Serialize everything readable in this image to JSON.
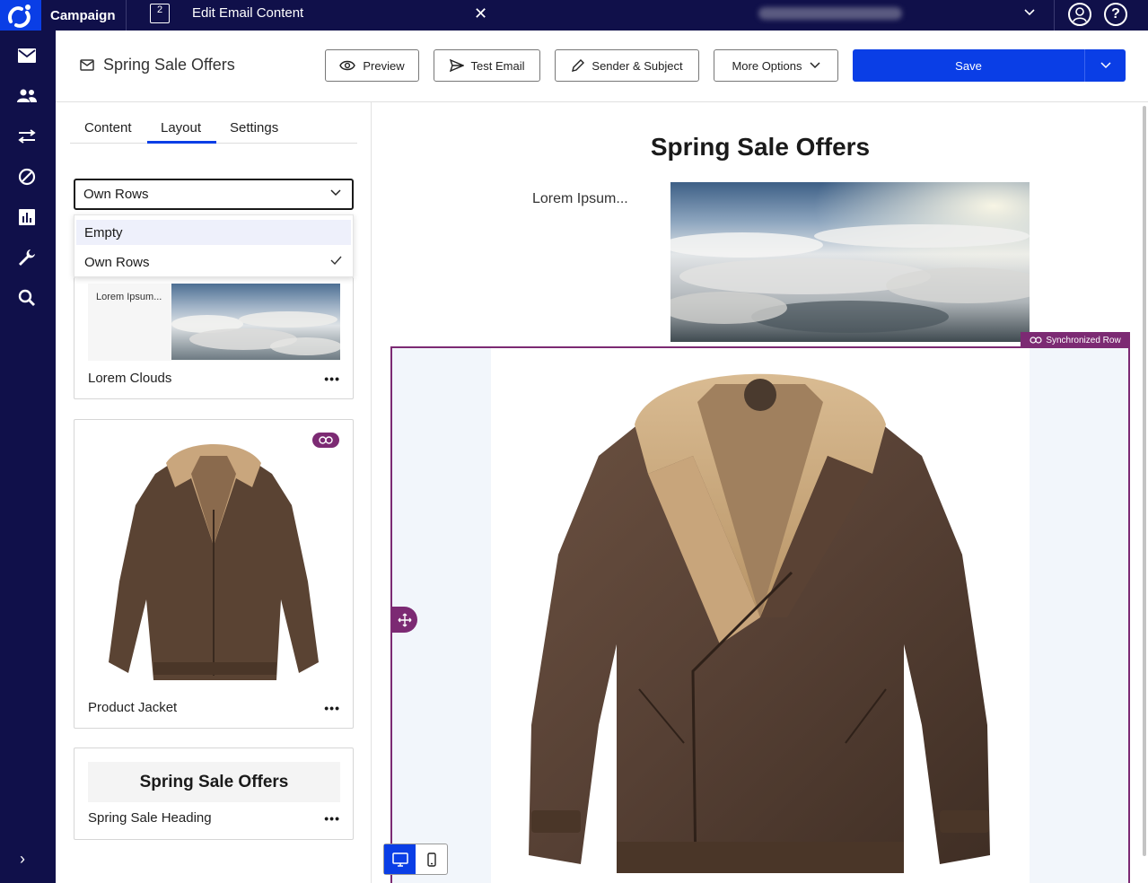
{
  "topbar": {
    "app_name": "Campaign",
    "page_icon_num": "2",
    "page_title": "Edit Email Content"
  },
  "header": {
    "email_title": "Spring Sale Offers",
    "preview_label": "Preview",
    "test_email_label": "Test Email",
    "sender_subject_label": "Sender & Subject",
    "more_options_label": "More Options",
    "save_label": "Save"
  },
  "panel": {
    "tabs": [
      "Content",
      "Layout",
      "Settings"
    ],
    "active_tab": "Layout",
    "select_value": "Own Rows",
    "dropdown_options": [
      "Empty",
      "Own Rows"
    ],
    "cards": [
      {
        "label": "Lorem Clouds",
        "thumb_text": "Lorem Ipsum..."
      },
      {
        "label": "Product Jacket"
      },
      {
        "label": "Spring Sale Heading",
        "thumb_text": "Spring Sale Offers"
      }
    ],
    "dots": "•••"
  },
  "canvas": {
    "heading": "Spring Sale Offers",
    "lorem": "Lorem Ipsum...",
    "sync_tag": "Synchronized Row"
  },
  "colors": {
    "nav_bg": "#10104a",
    "accent": "#0a3ee6",
    "sync": "#7c2a73"
  }
}
